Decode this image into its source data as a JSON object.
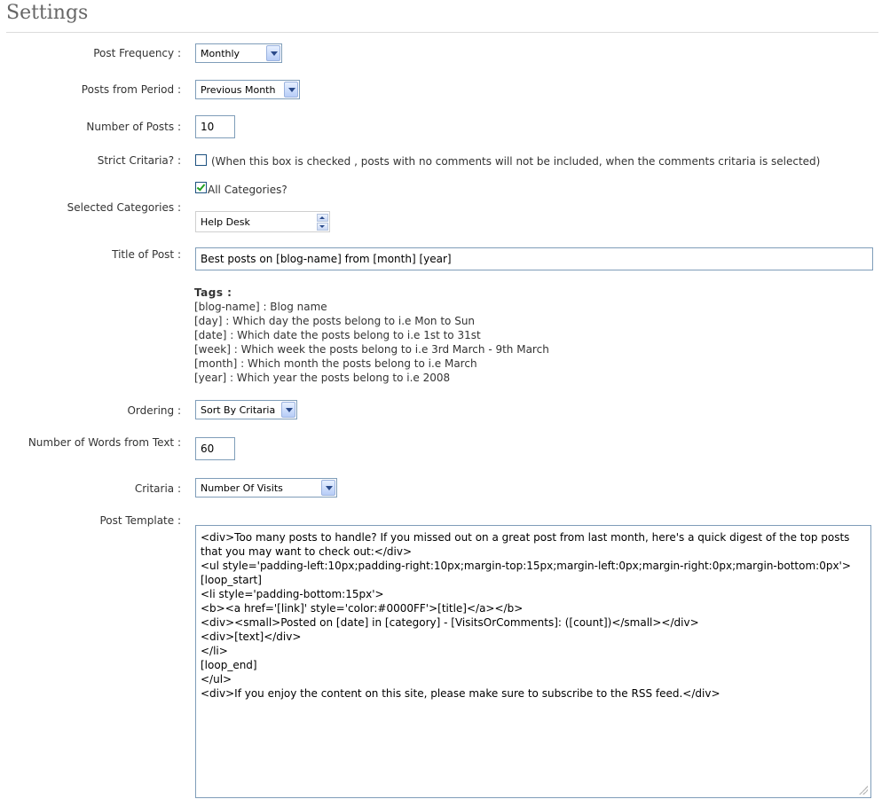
{
  "page": {
    "title": "Settings"
  },
  "labels": {
    "post_frequency": "Post Frequency :",
    "posts_from_period": "Posts from Period :",
    "number_of_posts": "Number of Posts :",
    "strict_critaria": "Strict Critaria? :",
    "selected_categories": "Selected Categories :",
    "title_of_post": "Title of Post :",
    "ordering": "Ordering :",
    "number_of_words": "Number of Words from Text :",
    "critaria": "Critaria :",
    "post_template": "Post Template :"
  },
  "fields": {
    "post_frequency": "Monthly",
    "posts_from_period": "Previous Month",
    "number_of_posts": "10",
    "strict_critaria_checked": false,
    "strict_critaria_note": "(When this box is checked , posts with no comments will not be included, when the comments critaria is selected)",
    "all_categories_checked": true,
    "all_categories_label": "All Categories?",
    "selected_category": "Help Desk",
    "title_of_post": "Best posts on [blog-name] from [month] [year]",
    "ordering": "Sort By Critaria",
    "number_of_words": "60",
    "critaria": "Number Of Visits",
    "post_template": "<div>Too many posts to handle? If you missed out on a great post from last month, here's a quick digest of the top posts that you may want to check out:</div>\n<ul style='padding-left:10px;padding-right:10px;margin-top:15px;margin-left:0px;margin-right:0px;margin-bottom:0px'>\n[loop_start]\n<li style='padding-bottom:15px'>\n<b><a href='[link]' style='color:#0000FF'>[title]</a></b>\n<div><small>Posted on [date] in [category] - [VisitsOrComments]: ([count])</small></div>\n<div>[text]</div>\n</li>\n[loop_end]\n</ul>\n<div>If you enjoy the content on this site, please make sure to subscribe to the RSS feed.</div>"
  },
  "tags": {
    "title": "Tags :",
    "items": [
      "[blog-name] : Blog name",
      "[day] : Which day the posts belong to i.e Mon to Sun",
      "[date] : Which date the posts belong to i.e 1st to 31st",
      "[week] : Which week the posts belong to i.e 3rd March - 9th March",
      "[month] : Which month the posts belong to i.e March",
      "[year] : Which year the posts belong to i.e 2008"
    ]
  },
  "icons": {
    "dropdown": "chevron-down-icon",
    "spin_up": "spin-up-icon",
    "spin_down": "spin-down-icon",
    "resize": "resize-grip-icon"
  }
}
